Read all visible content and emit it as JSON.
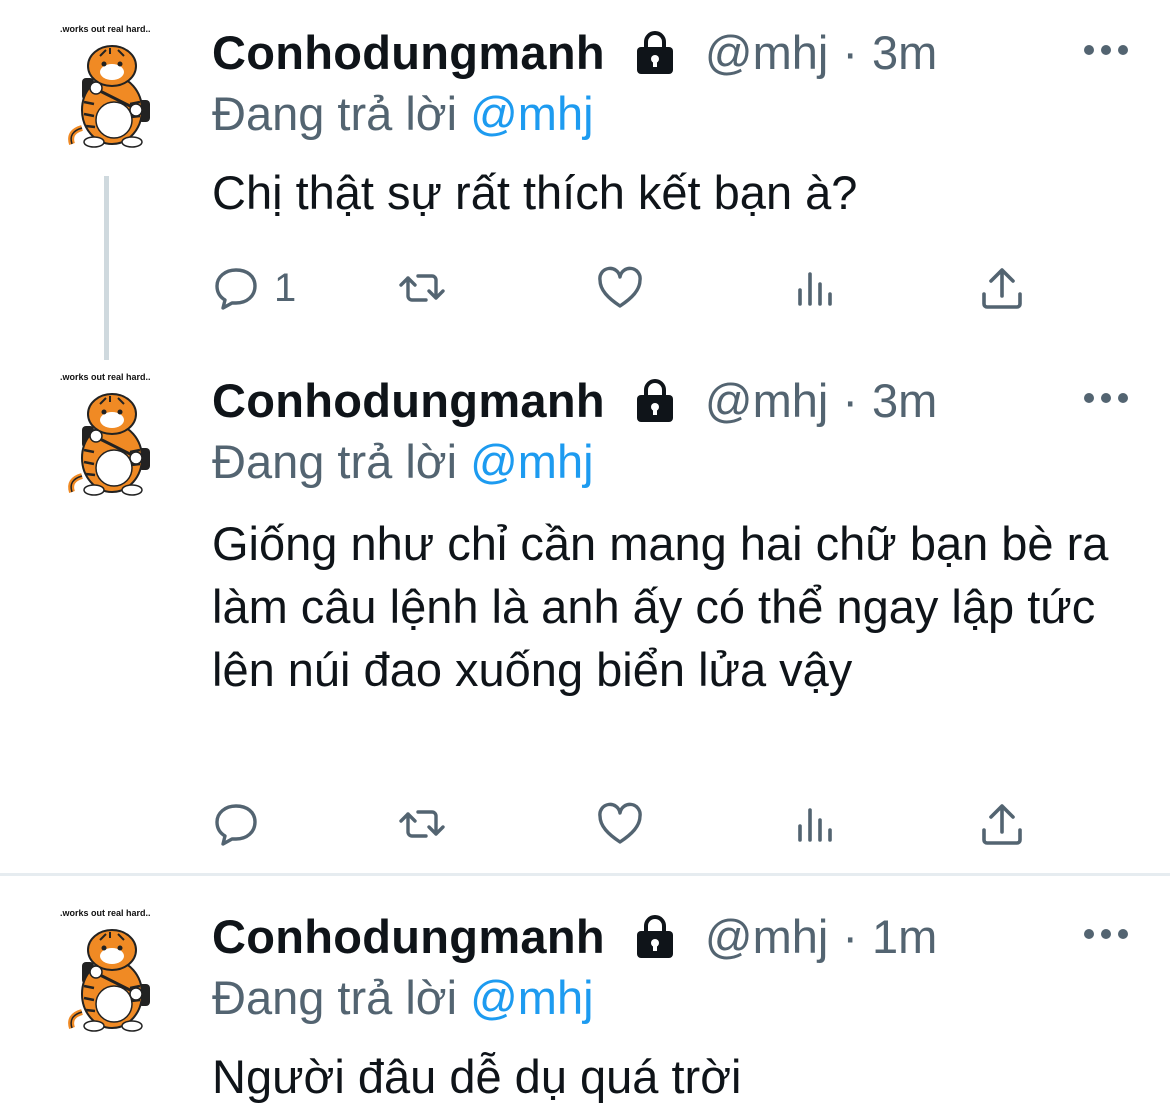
{
  "tweets": [
    {
      "avatar_caption": ".works out real hard..",
      "name": "Conhodungmanh",
      "handle": "@mhj",
      "separator": "·",
      "time": "3m",
      "reply_prefix": "Đang trả lời",
      "reply_mention": "@mhj",
      "text": "Chị thật sự rất thích kết bạn à?",
      "reply_count": "1"
    },
    {
      "avatar_caption": ".works out real hard..",
      "name": "Conhodungmanh",
      "handle": "@mhj",
      "separator": "·",
      "time": "3m",
      "reply_prefix": "Đang trả lời",
      "reply_mention": "@mhj",
      "text": "Giống như chỉ cần mang hai chữ bạn bè ra làm câu lệnh là anh ấy có thể ngay lập tức lên núi đao xuống biển lửa vậy",
      "reply_count": ""
    },
    {
      "avatar_caption": ".works out real hard..",
      "name": "Conhodungmanh",
      "handle": "@mhj",
      "separator": "·",
      "time": "1m",
      "reply_prefix": "Đang trả lời",
      "reply_mention": "@mhj",
      "text": "Người đâu dễ dụ quá trời",
      "reply_count": ""
    }
  ],
  "icons": {
    "lock": "lock-icon",
    "more": "more-icon",
    "reply": "reply-icon",
    "retweet": "retweet-icon",
    "like": "heart-icon",
    "views": "views-icon",
    "share": "share-icon"
  },
  "colors": {
    "text": "#0f1419",
    "secondary": "#536471",
    "link": "#1d9bf0",
    "thread_line": "#cfd9de",
    "divider": "#e6ecf0"
  }
}
